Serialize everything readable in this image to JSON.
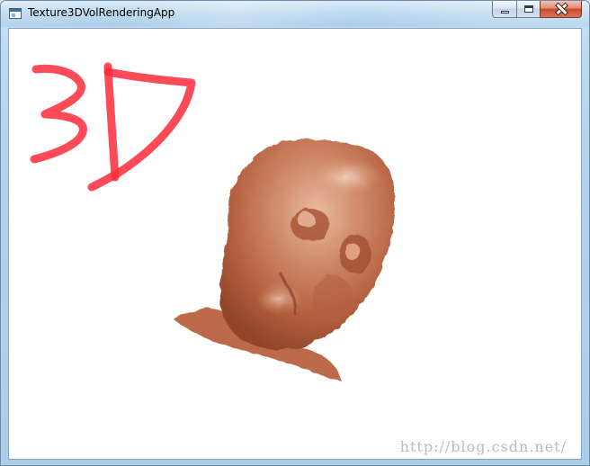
{
  "window": {
    "title": "Texture3DVolRenderingApp",
    "caption_buttons": {
      "minimize_icon": "minimize-icon",
      "maximize_icon": "maximize-icon",
      "close_icon": "close-icon"
    }
  },
  "viewport": {
    "annotation_text": "3D",
    "annotation_color": "#ff2b3a",
    "volume_color": "#c4714f",
    "background_color": "#ffffff"
  },
  "watermark": "http://blog.csdn.net/"
}
